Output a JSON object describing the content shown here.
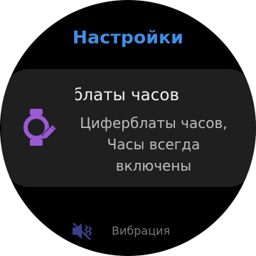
{
  "header": {
    "title": "Настройки"
  },
  "card": {
    "title_scrolling": "Циферблаты часов",
    "description": "Циферблаты часов, Часы всегда включены",
    "icon": "watch-face-edit-icon",
    "icon_color": "#9b59d6"
  },
  "next_item": {
    "label": "Вибрация",
    "icon": "vibration-mute-icon",
    "icon_color": "#3b3f8a"
  },
  "colors": {
    "title": "#3f8fe6",
    "card_background": "#1f1f1f",
    "background": "#000000"
  }
}
